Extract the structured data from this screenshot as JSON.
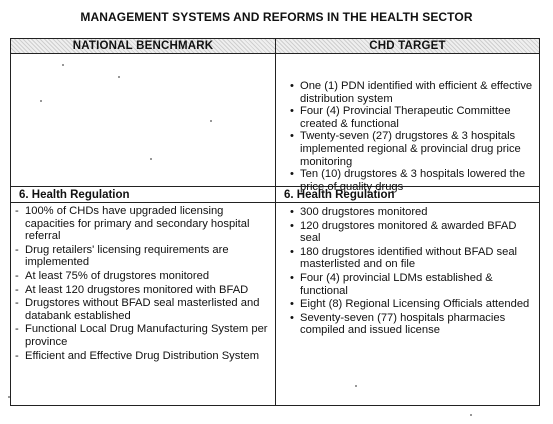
{
  "title": "MANAGEMENT SYSTEMS AND REFORMS IN THE HEALTH SECTOR",
  "columns": {
    "left_header": "NATIONAL BENCHMARK",
    "right_header": "CHD TARGET"
  },
  "chd_target_top": [
    "One (1) PDN  identified with efficient & effective  distribution system",
    "Four (4)  Provincial  Therapeutic Committee created & functional",
    "Twenty-seven (27)  drugstores & 3 hospitals implemented regional  & provincial drug price  monitoring",
    "Ten (10) drugstores & 3 hospitals lowered the price of quality drugs"
  ],
  "section_label": "6.  Health  Regulation",
  "national_benchmark": [
    "100% of CHDs have upgraded licensing capacities  for  primary and secondary hospital referral",
    "Drug retailers'  licensing requirements are implemented",
    "At least  75%  of drugstores  monitored",
    "At least 120 drugstores monitored with BFAD",
    "Drugstores without BFAD seal masterlisted and databank established",
    "Functional Local  Drug Manufacturing System  per province",
    "Efficient and Effective Drug  Distribution System"
  ],
  "chd_target_regulation": [
    "300 drugstores  monitored",
    "120 drugstores  monitored & awarded BFAD seal",
    "180  drugstores  identified without  BFAD seal masterlisted and on file",
    "Four (4)  provincial LDMs established & functional",
    "Eight (8)  Regional  Licensing Officials attended",
    "Seventy-seven (77)  hospitals pharmacies compiled and issued license"
  ]
}
